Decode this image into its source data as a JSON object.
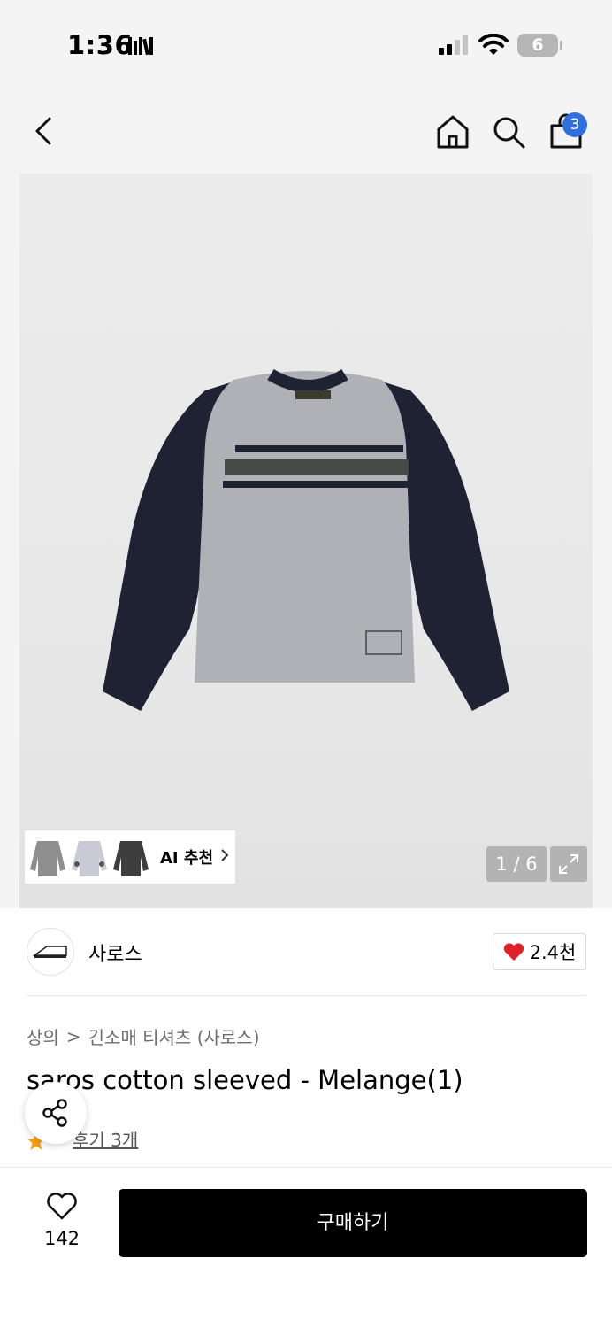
{
  "status": {
    "time": "1:36",
    "battery": "6"
  },
  "header": {
    "cart_count": "3"
  },
  "gallery": {
    "ai_label": "AI 추천",
    "page_indicator": "1 / 6"
  },
  "brand": {
    "name": "사로스",
    "likes": "2.4천"
  },
  "breadcrumb": {
    "category": "상의",
    "separator": ">",
    "subcategory": "긴소매 티셔츠 (사로스)"
  },
  "product": {
    "title": "saros cotton sleeved - Melange(1)",
    "review_link": "후기 3개"
  },
  "bottom": {
    "wish_count": "142",
    "buy_label": "구매하기"
  },
  "colors": {
    "cart_badge": "#2f6fe0",
    "heart": "#e0202a",
    "star": "#f3a20f",
    "buy_button": "#000000"
  }
}
